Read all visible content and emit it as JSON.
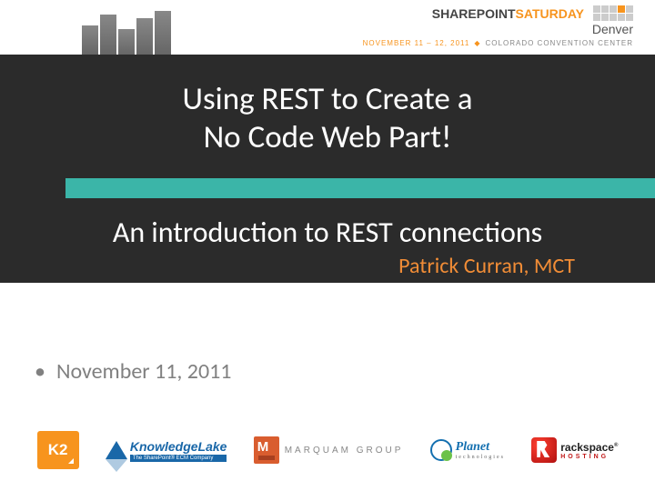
{
  "header": {
    "event_name_part1": "SHAREPOINT",
    "event_name_part2": "SATURDAY",
    "city": "Denver",
    "date_text": "NOVEMBER 11 – 12, 2011",
    "venue": "COLORADO CONVENTION CENTER"
  },
  "slide": {
    "title_line1": "Using REST to Create a",
    "title_line2": "No Code Web Part!",
    "subtitle": "An introduction to REST connections",
    "author": "Patrick Curran, MCT",
    "date": "November 11, 2011"
  },
  "sponsors": {
    "k2": "K2",
    "knowledgelake": "KnowledgeLake",
    "knowledgelake_tag": "The SharePoint® ECM Company",
    "marquam": "MARQUAM GROUP",
    "planet": "Planet",
    "planet_sub": "technologies",
    "rackspace": "rackspace",
    "rackspace_sub": "HOSTING"
  }
}
